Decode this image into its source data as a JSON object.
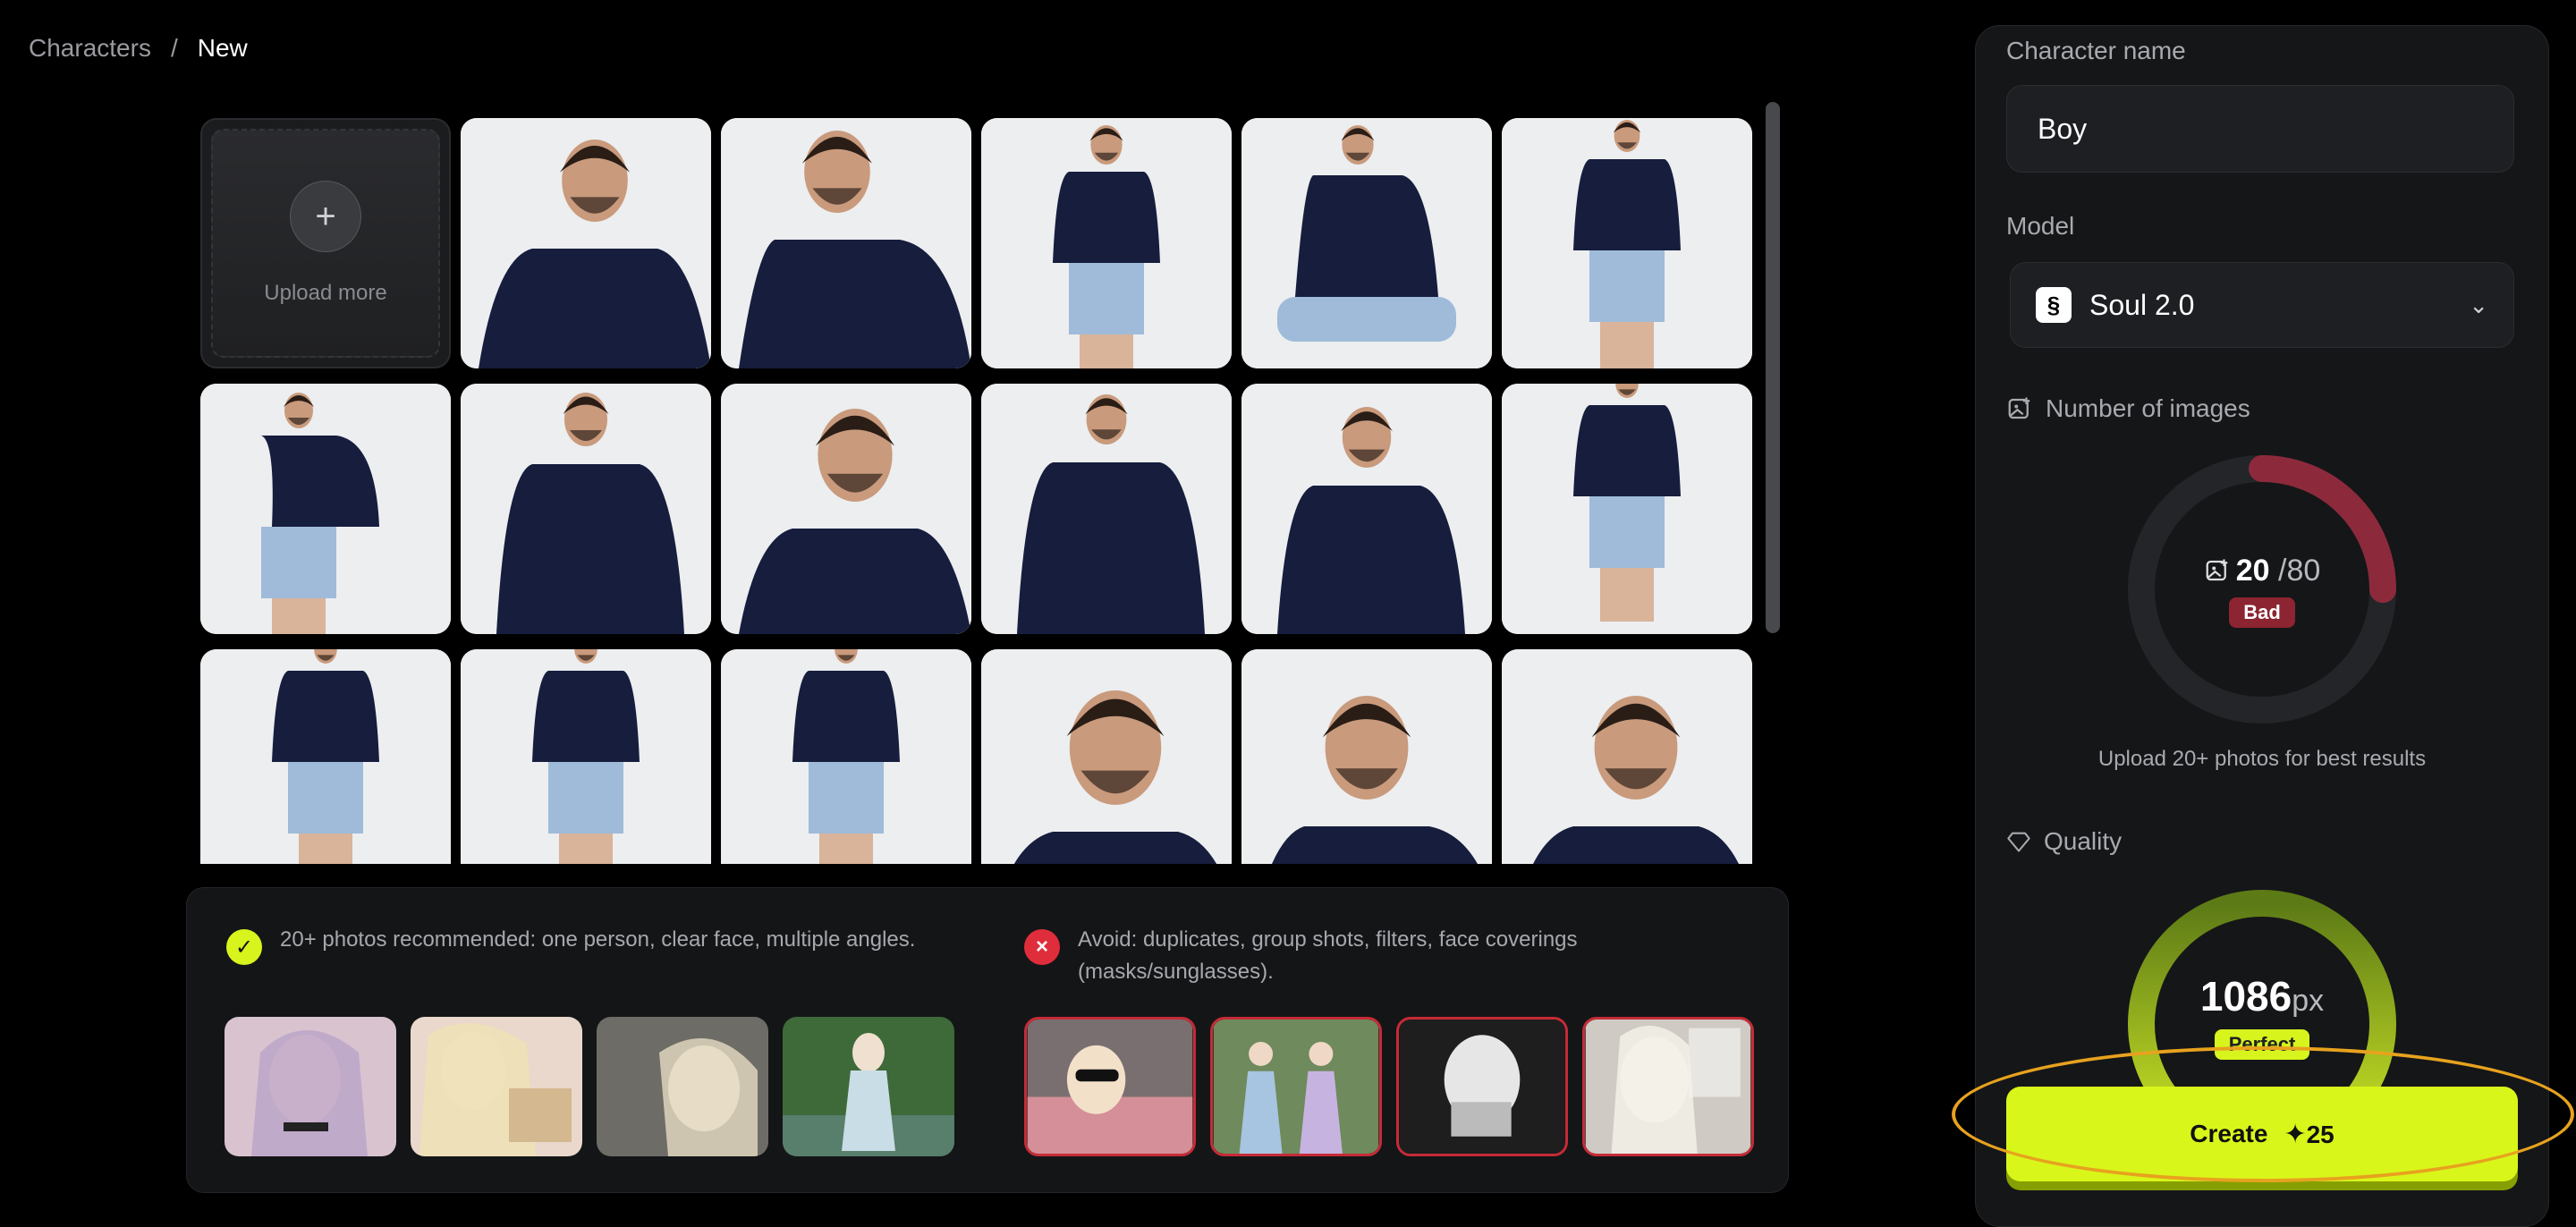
{
  "breadcrumb": {
    "parent": "Characters",
    "separator": "/",
    "current": "New"
  },
  "upload": {
    "label": "Upload more",
    "icon": "plus-icon"
  },
  "photos_count_visible": 17,
  "guidance": {
    "recommended_text": "20+ photos recommended: one person, clear face, multiple angles.",
    "avoid_text": "Avoid: duplicates, group shots, filters, face coverings (masks/sunglasses).",
    "good_icon": "check-icon",
    "bad_icon": "x-icon"
  },
  "panel": {
    "name_label": "Character name",
    "name_value": "Boy",
    "model_label": "Model",
    "model_value": "Soul 2.0",
    "images_label": "Number of images",
    "images_count": "20",
    "images_max": "/80",
    "images_status": "Bad",
    "images_progress": 0.25,
    "images_hint": "Upload 20+ photos for best results",
    "quality_label": "Quality",
    "quality_value": "1086",
    "quality_unit": "px",
    "quality_status": "Perfect",
    "create_label": "Create",
    "create_cost": "25"
  },
  "colors": {
    "accent": "#d9f61a",
    "bad": "#8c2431",
    "highlight": "#e7a21e"
  }
}
